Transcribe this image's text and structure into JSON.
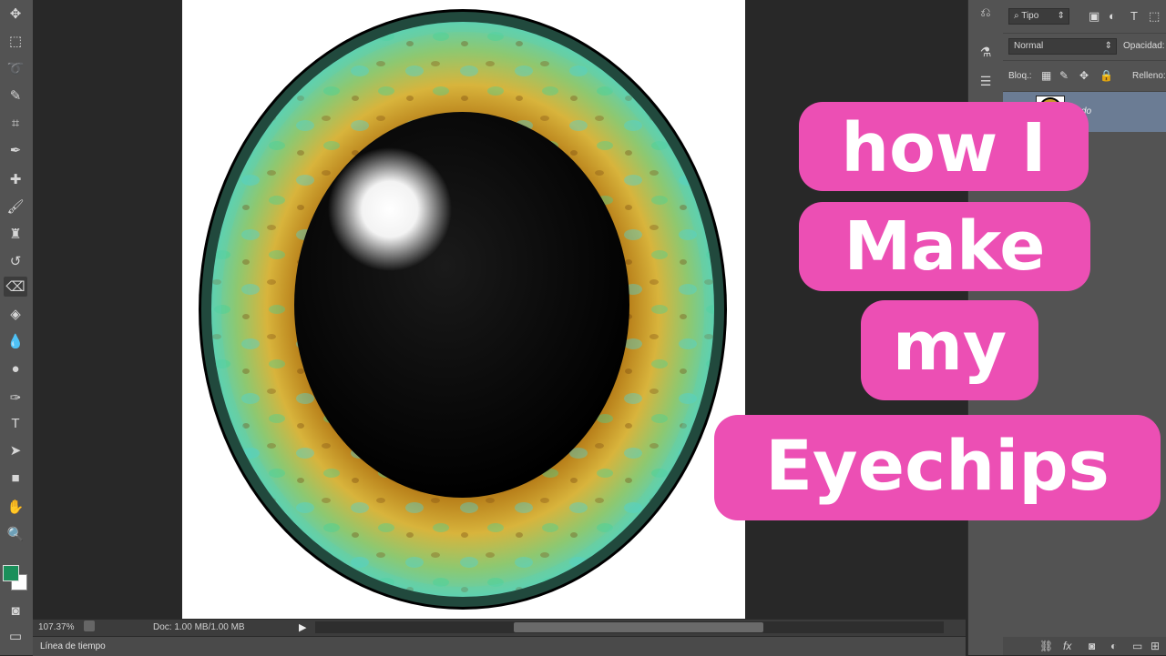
{
  "status_bar": {
    "zoom": "107.37%",
    "doc_info": "Doc: 1.00 MB/1.00 MB"
  },
  "timeline_tab": {
    "label": "Línea de tiempo"
  },
  "layers_panel": {
    "filter_kind": "Tipo",
    "blend_mode": "Normal",
    "opacity_label": "Opacidad:",
    "lock_label": "Bloq.:",
    "fill_label": "Relleno:",
    "layer_name": "...ndo"
  },
  "tools": [
    {
      "name": "move-tool-icon",
      "glyph": "✥"
    },
    {
      "name": "marquee-tool-icon",
      "glyph": "⬚"
    },
    {
      "name": "lasso-tool-icon",
      "glyph": "➰"
    },
    {
      "name": "quick-select-tool-icon",
      "glyph": "✎"
    },
    {
      "name": "crop-tool-icon",
      "glyph": "⌗"
    },
    {
      "name": "eyedropper-tool-icon",
      "glyph": "✒"
    },
    {
      "name": "healing-brush-tool-icon",
      "glyph": "✚"
    },
    {
      "name": "brush-tool-icon",
      "glyph": "🖌"
    },
    {
      "name": "clone-stamp-tool-icon",
      "glyph": "♜"
    },
    {
      "name": "history-brush-tool-icon",
      "glyph": "↺"
    },
    {
      "name": "eraser-tool-icon",
      "glyph": "⌫"
    },
    {
      "name": "paint-bucket-tool-icon",
      "glyph": "◈"
    },
    {
      "name": "blur-tool-icon",
      "glyph": "💧"
    },
    {
      "name": "dodge-tool-icon",
      "glyph": "●"
    },
    {
      "name": "pen-tool-icon",
      "glyph": "✑"
    },
    {
      "name": "type-tool-icon",
      "glyph": "T"
    },
    {
      "name": "path-selection-tool-icon",
      "glyph": "➤"
    },
    {
      "name": "rectangle-tool-icon",
      "glyph": "■"
    },
    {
      "name": "hand-tool-icon",
      "glyph": "✋"
    },
    {
      "name": "zoom-tool-icon",
      "glyph": "🔍"
    }
  ],
  "colors": {
    "foreground": "#1a8f5a",
    "background": "#ffffff",
    "overlay_pink": "#ec4fb4",
    "selected_layer": "#6b7c94"
  },
  "overlay_text": {
    "line1": "how I",
    "line2": "Make",
    "line3": "my",
    "line4": "Eyechips"
  }
}
